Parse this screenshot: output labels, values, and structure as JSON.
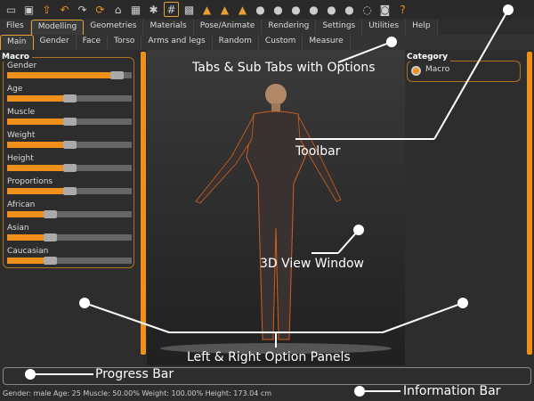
{
  "toolbar": {
    "icons": [
      "undo-icon",
      "redo-icon",
      "reset-icon",
      "help-icon"
    ],
    "help": "?"
  },
  "tabs": [
    "Files",
    "Modelling",
    "Geometries",
    "Materials",
    "Pose/Animate",
    "Rendering",
    "Settings",
    "Utilities",
    "Help"
  ],
  "active_tab": "Modelling",
  "subtabs": [
    "Main",
    "Gender",
    "Face",
    "Torso",
    "Arms and legs",
    "Random",
    "Custom",
    "Measure"
  ],
  "active_subtab": "Main",
  "left_panel": {
    "group": "Macro",
    "sliders": [
      {
        "label": "Gender",
        "value": 0.93
      },
      {
        "label": "Age",
        "value": 0.5
      },
      {
        "label": "Muscle",
        "value": 0.5
      },
      {
        "label": "Weight",
        "value": 0.5
      },
      {
        "label": "Height",
        "value": 0.5
      },
      {
        "label": "Proportions",
        "value": 0.5
      },
      {
        "label": "African",
        "value": 0.33
      },
      {
        "label": "Asian",
        "value": 0.33
      },
      {
        "label": "Caucasian",
        "value": 0.33
      }
    ]
  },
  "right_panel": {
    "group": "Category",
    "option": "Macro"
  },
  "info_bar": "Gender: male Age: 25 Muscle: 50.00% Weight: 100.00% Height: 173.04 cm",
  "annotations": {
    "tabs": "Tabs & Sub Tabs with Options",
    "toolbar": "Toolbar",
    "view": "3D View Window",
    "panels": "Left & Right Option Panels",
    "progress": "Progress Bar",
    "info": "Information Bar"
  },
  "colors": {
    "accent": "#f0901a",
    "background": "#2d2d2d"
  }
}
